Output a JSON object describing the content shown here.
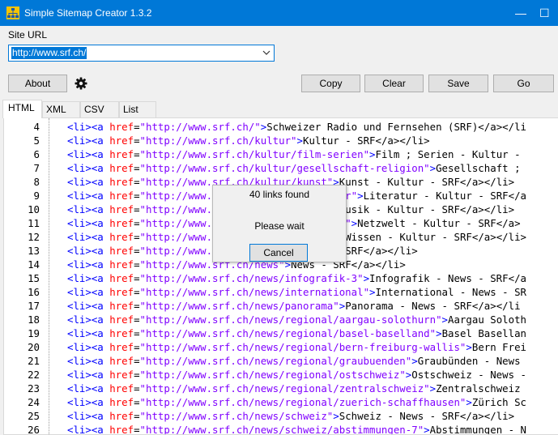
{
  "window": {
    "title": "Simple Sitemap Creator 1.3.2",
    "minimize_glyph": "—",
    "maximize_glyph": "☐"
  },
  "site_url": {
    "label": "Site URL",
    "value": "http://www.srf.ch/"
  },
  "toolbar": {
    "about": "About",
    "copy": "Copy",
    "clear": "Clear",
    "save": "Save",
    "go": "Go"
  },
  "tabs": [
    "HTML",
    "XML",
    "CSV",
    "List"
  ],
  "colors": {
    "accent": "#0078d7",
    "tag": "#0000ff",
    "attr": "#ff0000",
    "value": "#8000ff"
  },
  "editor": {
    "lines": [
      {
        "n": "4",
        "href": "http://www.srf.ch/",
        "text": "Schweizer Radio und Fernsehen (SRF)</a></li"
      },
      {
        "n": "5",
        "href": "http://www.srf.ch/kultur",
        "text": "Kultur - SRF</a></li>"
      },
      {
        "n": "6",
        "href": "http://www.srf.ch/kultur/film-serien",
        "text": "Film ; Serien - Kultur -"
      },
      {
        "n": "7",
        "href": "http://www.srf.ch/kultur/gesellschaft-religion",
        "text": "Gesellschaft ;"
      },
      {
        "n": "8",
        "href": "http://www.srf.ch/kultur/kunst",
        "text": "Kunst - Kultur - SRF</a></li>"
      },
      {
        "n": "9",
        "href": "http://www.srf.ch/kultur/literatur",
        "text": "Literatur - Kultur - SRF</a"
      },
      {
        "n": "10",
        "href": "http://www.srf.ch/kultur/musik",
        "text": "Musik - Kultur - SRF</a></li>"
      },
      {
        "n": "11",
        "href": "http://www.srf.ch/kultur/netzwelt",
        "text": "Netzwelt - Kultur - SRF</a>"
      },
      {
        "n": "12",
        "href": "http://www.srf.ch/kultur/wissen",
        "text": "Wissen - Kultur - SRF</a></li>"
      },
      {
        "n": "13",
        "href": "http://www.srf.ch/meteo",
        "text": "Meteo - SRF</a></li>"
      },
      {
        "n": "14",
        "href": "http://www.srf.ch/news",
        "text": "News - SRF</a></li>"
      },
      {
        "n": "15",
        "href": "http://www.srf.ch/news/infografik-3",
        "text": "Infografik - News - SRF</a"
      },
      {
        "n": "16",
        "href": "http://www.srf.ch/news/international",
        "text": "International - News - SR"
      },
      {
        "n": "17",
        "href": "http://www.srf.ch/news/panorama",
        "text": "Panorama - News - SRF</a></li"
      },
      {
        "n": "18",
        "href": "http://www.srf.ch/news/regional/aargau-solothurn",
        "text": "Aargau Soloth"
      },
      {
        "n": "19",
        "href": "http://www.srf.ch/news/regional/basel-baselland",
        "text": "Basel Basellan"
      },
      {
        "n": "20",
        "href": "http://www.srf.ch/news/regional/bern-freiburg-wallis",
        "text": "Bern Frei"
      },
      {
        "n": "21",
        "href": "http://www.srf.ch/news/regional/graubuenden",
        "text": "Graubünden - News"
      },
      {
        "n": "22",
        "href": "http://www.srf.ch/news/regional/ostschweiz",
        "text": "Ostschweiz - News -"
      },
      {
        "n": "23",
        "href": "http://www.srf.ch/news/regional/zentralschweiz",
        "text": "Zentralschweiz"
      },
      {
        "n": "24",
        "href": "http://www.srf.ch/news/regional/zuerich-schaffhausen",
        "text": "Zürich Sc"
      },
      {
        "n": "25",
        "href": "http://www.srf.ch/news/schweiz",
        "text": "Schweiz - News - SRF</a></li>"
      },
      {
        "n": "26",
        "href": "http://www.srf.ch/news/schweiz/abstimmungen-7",
        "text": "Abstimmungen - N"
      }
    ]
  },
  "dialog": {
    "title": "40 links found",
    "message": "Please wait",
    "cancel": "Cancel"
  }
}
